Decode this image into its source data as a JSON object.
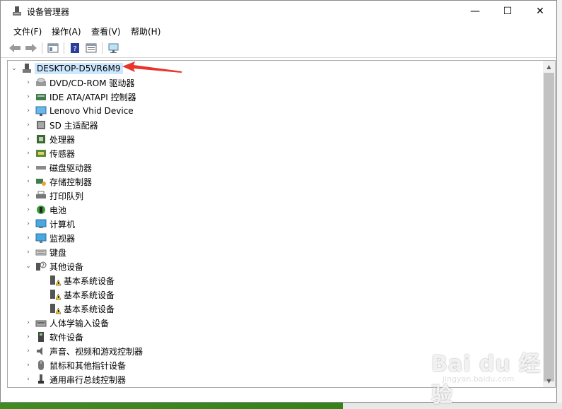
{
  "window": {
    "title": "设备管理器",
    "minimize": "—",
    "maximize": "☐",
    "close": "✕"
  },
  "menubar": {
    "items": [
      "文件(F)",
      "操作(A)",
      "查看(V)",
      "帮助(H)"
    ]
  },
  "tree": {
    "root": "DESKTOP-D5VR6M9",
    "categories": [
      {
        "label": "DVD/CD-ROM 驱动器",
        "icon": "dvd-drive-icon",
        "expanded": false
      },
      {
        "label": "IDE ATA/ATAPI 控制器",
        "icon": "ide-controller-icon",
        "expanded": false
      },
      {
        "label": "Lenovo Vhid Device",
        "icon": "display-device-icon",
        "expanded": false
      },
      {
        "label": "SD 主适配器",
        "icon": "sd-adapter-icon",
        "expanded": false
      },
      {
        "label": "处理器",
        "icon": "processor-icon",
        "expanded": false
      },
      {
        "label": "传感器",
        "icon": "sensor-icon",
        "expanded": false
      },
      {
        "label": "磁盘驱动器",
        "icon": "disk-drive-icon",
        "expanded": false
      },
      {
        "label": "存储控制器",
        "icon": "storage-controller-icon",
        "expanded": false
      },
      {
        "label": "打印队列",
        "icon": "printer-icon",
        "expanded": false
      },
      {
        "label": "电池",
        "icon": "battery-icon",
        "expanded": false
      },
      {
        "label": "计算机",
        "icon": "computer-icon",
        "expanded": false
      },
      {
        "label": "监视器",
        "icon": "monitor-icon",
        "expanded": false
      },
      {
        "label": "键盘",
        "icon": "keyboard-icon",
        "expanded": false
      },
      {
        "label": "其他设备",
        "icon": "other-devices-icon",
        "expanded": true,
        "children": [
          "基本系统设备",
          "基本系统设备",
          "基本系统设备"
        ]
      },
      {
        "label": "人体学输入设备",
        "icon": "hid-icon",
        "expanded": false
      },
      {
        "label": "软件设备",
        "icon": "software-device-icon",
        "expanded": false
      },
      {
        "label": "声音、视频和游戏控制器",
        "icon": "audio-icon",
        "expanded": false
      },
      {
        "label": "鼠标和其他指针设备",
        "icon": "mouse-icon",
        "expanded": false
      },
      {
        "label": "通用串行总线控制器",
        "icon": "usb-icon",
        "expanded": false
      }
    ]
  },
  "watermark": {
    "main": "Bai du 经验",
    "sub": "jingyan.baidu.com"
  },
  "colors": {
    "selection": "#cce8ff",
    "annotation": "#e8342b",
    "warning": "#f2c318"
  }
}
